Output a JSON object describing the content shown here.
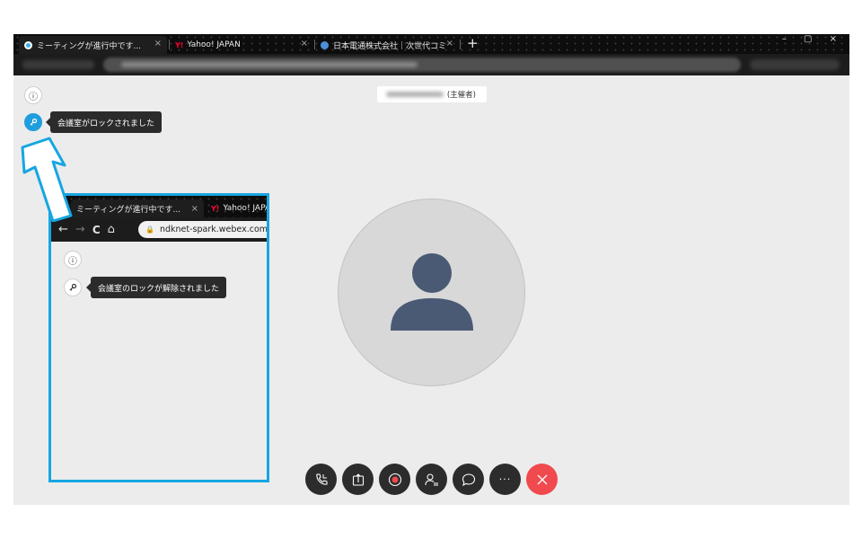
{
  "browser": {
    "tabs": [
      {
        "label": "ミーティングが進行中です...",
        "close": "×",
        "favicon_color": "#3ab0e8",
        "active": true
      },
      {
        "label": "Yahoo! JAPAN",
        "close": "×",
        "favicon_text": "Y!",
        "favicon_color": "#ff0033",
        "active": false
      },
      {
        "label": "日本電通株式会社｜次世代コミ",
        "close": "×",
        "favicon_color": "#4a8fd8",
        "active": false
      }
    ],
    "new_tab": "+",
    "window_controls": "–  ▢  ×"
  },
  "sidebar": {
    "info_icon": "ⓘ",
    "lock_icon": "🔑",
    "lock_tooltip": "会議室がロックされました"
  },
  "host_badge": {
    "suffix": "(主催者)"
  },
  "controls": [
    {
      "name": "audio-button",
      "icon": "phone-icon"
    },
    {
      "name": "share-button",
      "icon": "share-icon"
    },
    {
      "name": "record-button",
      "icon": "record-icon"
    },
    {
      "name": "participants-button",
      "icon": "participants-icon"
    },
    {
      "name": "chat-button",
      "icon": "chat-icon"
    },
    {
      "name": "more-button",
      "icon": "more-icon",
      "label": "···"
    },
    {
      "name": "leave-button",
      "icon": "close-icon",
      "color": "#f0494e"
    }
  ],
  "inset": {
    "tabs": [
      {
        "label": "ミーティングが進行中です...",
        "close": "×"
      },
      {
        "label": "Yahoo! JAPA",
        "favicon_text": "Y!"
      }
    ],
    "nav": {
      "back": "←",
      "forward": "→",
      "reload": "C",
      "home": "⌂"
    },
    "url": "ndknet-spark.webex.com/",
    "lock_tooltip": "会議室のロックが解除されました",
    "border_color": "#16a6e2"
  },
  "colors": {
    "accent_blue": "#1f9ede",
    "avatar_figure": "#4a5a75",
    "end_call_red": "#f0494e"
  }
}
